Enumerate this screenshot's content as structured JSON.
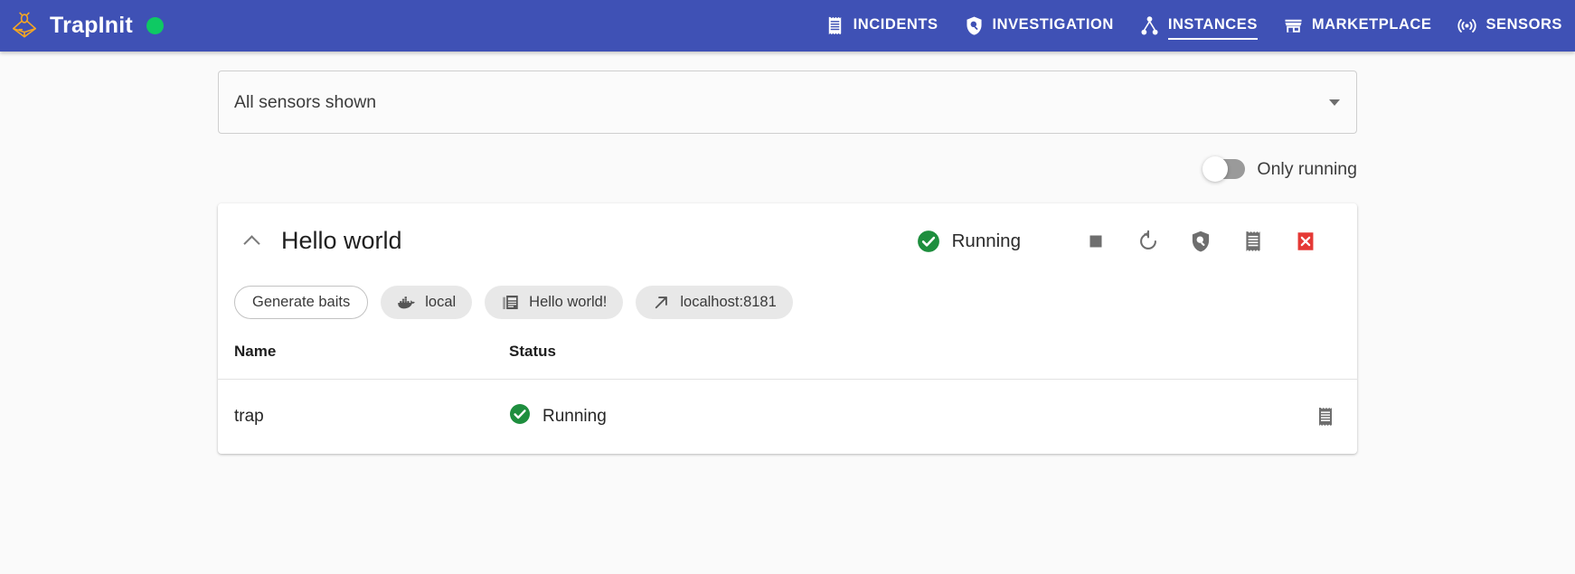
{
  "app": {
    "brand_name": "TrapInit",
    "brand_logo_icon": "bug-trap-logo-icon",
    "status_dot_icon": "online-status-dot",
    "status_dot_color": "#0ec963",
    "header_color": "#3f51b5"
  },
  "nav": {
    "items": [
      {
        "label": "INCIDENTS",
        "icon": "receipt-icon",
        "active": false
      },
      {
        "label": "INVESTIGATION",
        "icon": "shield-search-icon",
        "active": false
      },
      {
        "label": "INSTANCES",
        "icon": "account-tree-icon",
        "active": true
      },
      {
        "label": "MARKETPLACE",
        "icon": "storefront-icon",
        "active": false
      },
      {
        "label": "SENSORS",
        "icon": "sensors-icon",
        "active": false
      }
    ]
  },
  "filters": {
    "sensor_select": {
      "value": "All sensors shown",
      "caret_icon": "chevron-down-icon"
    },
    "only_running": {
      "label": "Only running",
      "enabled": false
    }
  },
  "instance": {
    "title": "Hello world",
    "collapse_icon": "chevron-up-icon",
    "status": {
      "label": "Running",
      "icon": "check-circle-icon",
      "color": "#1e8e3e"
    },
    "actions": [
      {
        "name": "stop-button",
        "icon": "stop-square-icon",
        "label": "Stop",
        "color": "#6e6e6e"
      },
      {
        "name": "restart-button",
        "icon": "restart-icon",
        "label": "Restart",
        "color": "#6e6e6e"
      },
      {
        "name": "investigation-button",
        "icon": "shield-search-icon",
        "label": "Investigation",
        "color": "#6e6e6e"
      },
      {
        "name": "logs-button",
        "icon": "receipt-icon",
        "label": "Logs",
        "color": "#6e6e6e"
      },
      {
        "name": "delete-button",
        "icon": "delete-icon",
        "label": "Delete",
        "color": "#e53935"
      }
    ],
    "chips": [
      {
        "label": "Generate baits",
        "icon": null,
        "style": "outlined"
      },
      {
        "label": "local",
        "icon": "docker-whale-icon",
        "style": "filled"
      },
      {
        "label": "Hello world!",
        "icon": "article-icon",
        "style": "filled"
      },
      {
        "label": "localhost:8181",
        "icon": "external-link-icon",
        "style": "filled"
      }
    ],
    "table": {
      "columns": [
        "Name",
        "Status"
      ],
      "rows": [
        {
          "name": "trap",
          "status": "Running",
          "status_icon": "check-circle-icon",
          "action_icon": "receipt-icon"
        }
      ]
    }
  }
}
